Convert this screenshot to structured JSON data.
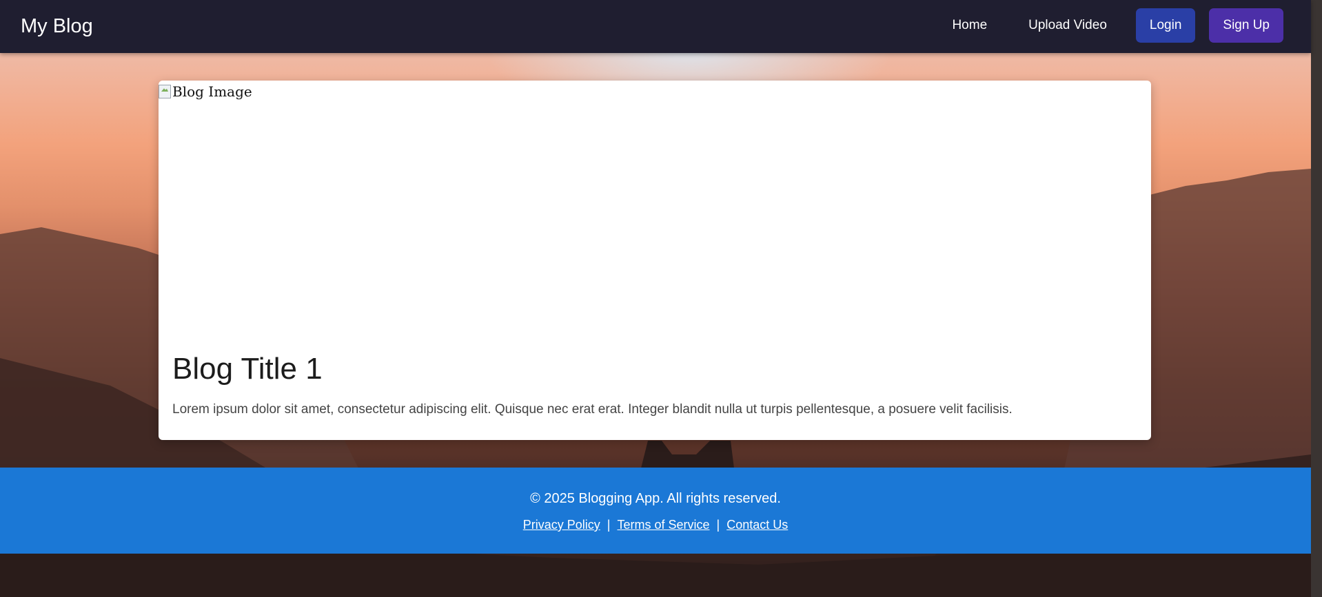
{
  "navbar": {
    "brand": "My Blog",
    "links": [
      "Home",
      "Upload Video"
    ],
    "login_label": "Login",
    "signup_label": "Sign Up",
    "colors": {
      "background": "#1f1e30",
      "login": "#2a3fa6",
      "signup": "#4c2fa8"
    }
  },
  "post": {
    "image_alt": "Blog Image",
    "title": "Blog Title 1",
    "excerpt": "Lorem ipsum dolor sit amet, consectetur adipiscing elit. Quisque nec erat erat. Integer blandit nulla ut turpis pellentesque, a posuere velit facilisis."
  },
  "footer": {
    "copyright": "© 2025 Blogging App. All rights reserved.",
    "links": [
      "Privacy Policy",
      "Terms of Service",
      "Contact Us"
    ],
    "separator": "|",
    "color": "#1b78d6"
  }
}
